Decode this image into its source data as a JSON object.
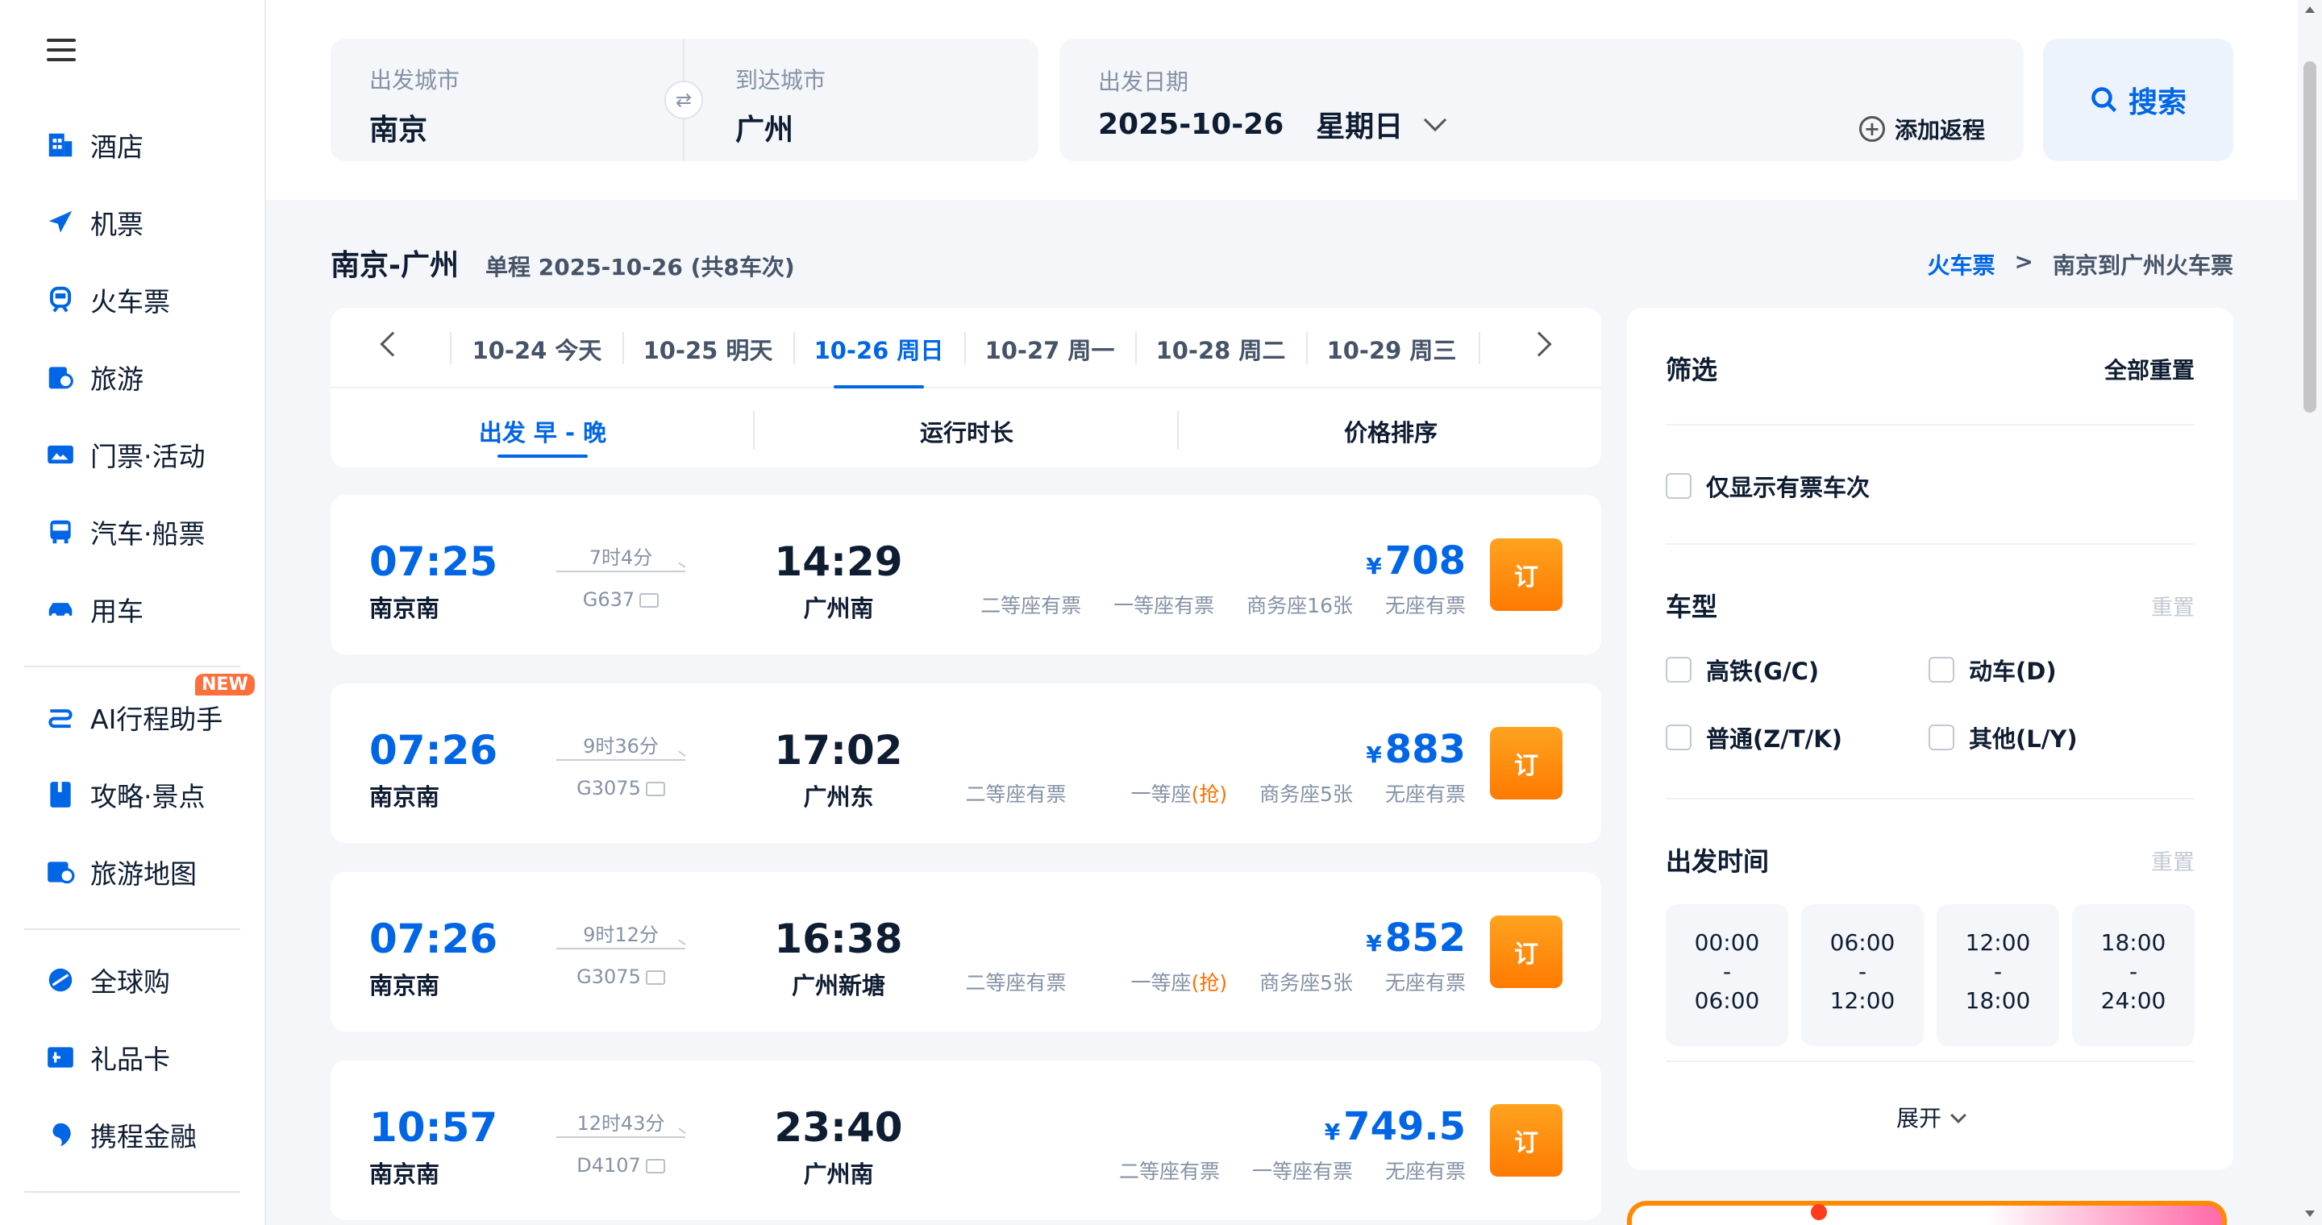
{
  "sidebar": {
    "items": [
      {
        "label": "酒店",
        "icon": "hotel-icon"
      },
      {
        "label": "机票",
        "icon": "plane-icon"
      },
      {
        "label": "火车票",
        "icon": "train-icon"
      },
      {
        "label": "旅游",
        "icon": "travel-icon"
      },
      {
        "label": "门票·活动",
        "icon": "ticket-icon"
      },
      {
        "label": "汽车·船票",
        "icon": "bus-icon"
      },
      {
        "label": "用车",
        "icon": "car-icon"
      },
      {
        "label": "AI行程助手",
        "icon": "ai-route-icon",
        "badge": "NEW"
      },
      {
        "label": "攻略·景点",
        "icon": "guide-icon"
      },
      {
        "label": "旅游地图",
        "icon": "map-icon"
      },
      {
        "label": "全球购",
        "icon": "global-shop-icon"
      },
      {
        "label": "礼品卡",
        "icon": "gift-card-icon"
      },
      {
        "label": "携程金融",
        "icon": "finance-icon"
      }
    ]
  },
  "search": {
    "from_label": "出发城市",
    "from_value": "南京",
    "to_label": "到达城市",
    "to_value": "广州",
    "date_label": "出发日期",
    "date_value": "2025-10-26",
    "weekday": "星期日",
    "add_return": "添加返程",
    "search_button": "搜索"
  },
  "route": {
    "title": "南京-广州",
    "subtitle": "单程 2025-10-26 (共8车次)"
  },
  "breadcrumb": {
    "link": "火车票",
    "separator": ">",
    "current": "南京到广州火车票"
  },
  "date_tabs": [
    {
      "date": "10-24",
      "day": "今天",
      "active": false
    },
    {
      "date": "10-25",
      "day": "明天",
      "active": false
    },
    {
      "date": "10-26",
      "day": "周日",
      "active": true
    },
    {
      "date": "10-27",
      "day": "周一",
      "active": false
    },
    {
      "date": "10-28",
      "day": "周二",
      "active": false
    },
    {
      "date": "10-29",
      "day": "周三",
      "active": false
    }
  ],
  "sort_tabs": [
    {
      "label": "出发  早 - 晚",
      "active": true
    },
    {
      "label": "运行时长",
      "active": false
    },
    {
      "label": "价格排序",
      "active": false
    }
  ],
  "trains": [
    {
      "dep_time": "07:25",
      "dep_station": "南京南",
      "duration": "7时4分",
      "train_no": "G637",
      "arr_time": "14:29",
      "arr_station": "广州南",
      "currency": "¥",
      "price": "708",
      "seats": [
        "二等座有票",
        "一等座有票",
        "商务座16张",
        "无座有票"
      ],
      "grab": [],
      "book": "订"
    },
    {
      "dep_time": "07:26",
      "dep_station": "南京南",
      "duration": "9时36分",
      "train_no": "G3075",
      "arr_time": "17:02",
      "arr_station": "广州东",
      "currency": "¥",
      "price": "883",
      "seats": [
        "二等座有票",
        "一等座",
        "商务座5张",
        "无座有票"
      ],
      "grab": [
        1
      ],
      "grab_text": "(抢)",
      "book": "订"
    },
    {
      "dep_time": "07:26",
      "dep_station": "南京南",
      "duration": "9时12分",
      "train_no": "G3075",
      "arr_time": "16:38",
      "arr_station": "广州新塘",
      "currency": "¥",
      "price": "852",
      "seats": [
        "二等座有票",
        "一等座",
        "商务座5张",
        "无座有票"
      ],
      "grab": [
        1
      ],
      "grab_text": "(抢)",
      "book": "订"
    },
    {
      "dep_time": "10:57",
      "dep_station": "南京南",
      "duration": "12时43分",
      "train_no": "D4107",
      "arr_time": "23:40",
      "arr_station": "广州南",
      "currency": "¥",
      "price": "749.5",
      "seats": [
        "二等座有票",
        "一等座有票",
        "无座有票"
      ],
      "grab": [],
      "book": "订"
    }
  ],
  "filter": {
    "title": "筛选",
    "reset_all": "全部重置",
    "only_available": "仅显示有票车次",
    "train_type_title": "车型",
    "reset": "重置",
    "train_types": [
      "高铁(G/C)",
      "动车(D)",
      "普通(Z/T/K)",
      "其他(L/Y)"
    ],
    "dep_time_title": "出发时间",
    "time_slots": [
      {
        "from": "00:00",
        "sep": "-",
        "to": "06:00"
      },
      {
        "from": "06:00",
        "sep": "-",
        "to": "12:00"
      },
      {
        "from": "12:00",
        "sep": "-",
        "to": "18:00"
      },
      {
        "from": "18:00",
        "sep": "-",
        "to": "24:00"
      }
    ],
    "expand": "展开"
  },
  "colors": {
    "accent": "#0066e6",
    "book_button": "#ff8a00",
    "grab": "#ff6f00"
  }
}
